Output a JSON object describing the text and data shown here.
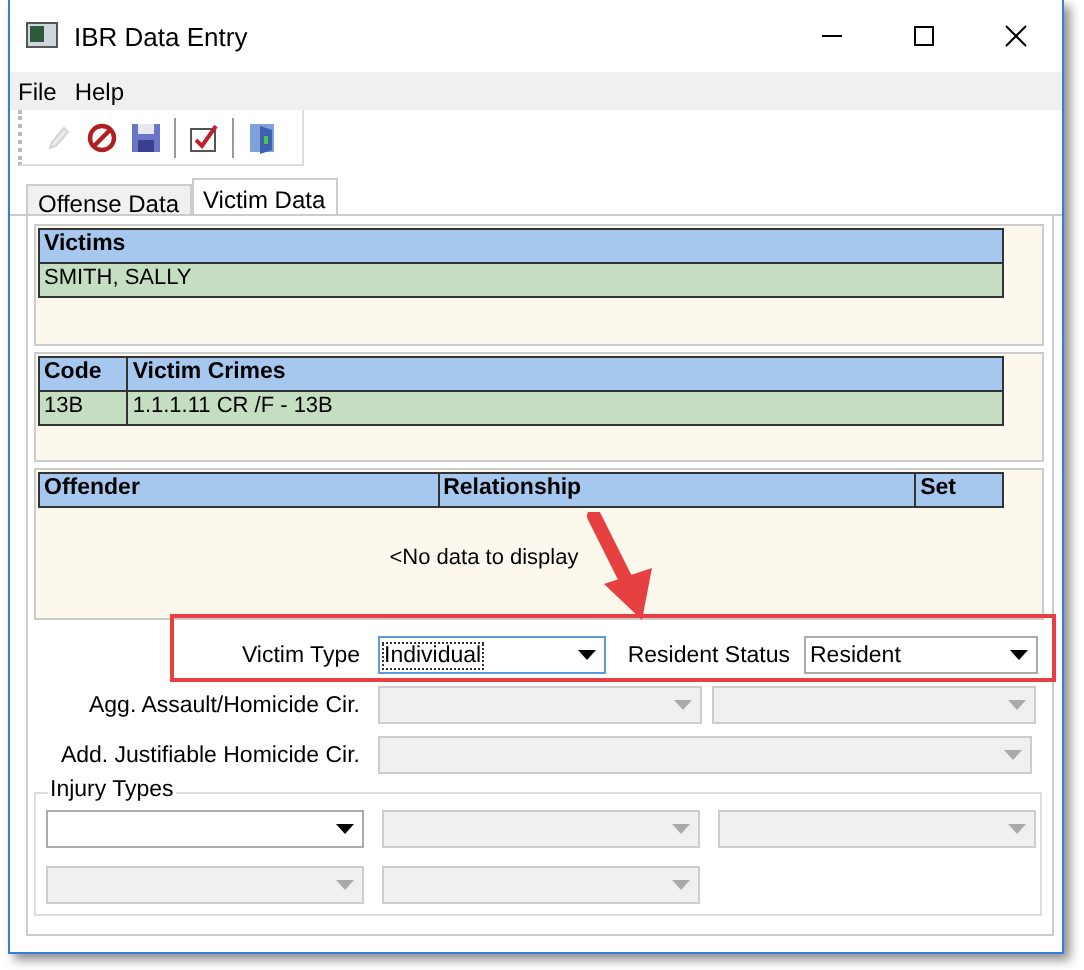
{
  "window": {
    "title": "IBR Data Entry"
  },
  "menu": [
    "File",
    "Help"
  ],
  "toolbar": [
    {
      "kind": "pencil",
      "disabled": true
    },
    {
      "kind": "cancel",
      "disabled": false
    },
    {
      "kind": "save",
      "disabled": false
    },
    {
      "kind": "check",
      "disabled": false
    },
    {
      "kind": "exit",
      "disabled": false
    }
  ],
  "tabs": [
    {
      "label": "Offense Data",
      "selected": false
    },
    {
      "label": "Victim Data",
      "selected": true
    }
  ],
  "victims": {
    "columns": [
      "Victims"
    ],
    "rows": [
      [
        "SMITH, SALLY"
      ]
    ]
  },
  "crimes": {
    "columns": [
      "Code",
      "Victim Crimes"
    ],
    "rows": [
      [
        "13B",
        "1.1.1.11 CR /F - 13B"
      ]
    ]
  },
  "offenders": {
    "columns": [
      "Offender",
      "Relationship",
      "Set"
    ],
    "empty_text": "<No data to display"
  },
  "victim_type": {
    "label": "Victim Type",
    "value": "Individual",
    "focused": true,
    "disabled": false
  },
  "resident_status": {
    "label": "Resident Status",
    "value": "Resident",
    "focused": false,
    "disabled": false
  },
  "agg_assault": {
    "label": "Agg. Assault/Homicide Cir.",
    "combos": [
      {
        "disabled": true
      },
      {
        "disabled": true
      }
    ]
  },
  "justifiable": {
    "label": "Add. Justifiable Homicide Cir.",
    "combos": [
      {
        "disabled": true
      }
    ]
  },
  "injury_types": {
    "title": "Injury Types",
    "combos": [
      {
        "disabled": false
      },
      {
        "disabled": true
      },
      {
        "disabled": true
      },
      {
        "disabled": true
      },
      {
        "disabled": true
      }
    ]
  }
}
